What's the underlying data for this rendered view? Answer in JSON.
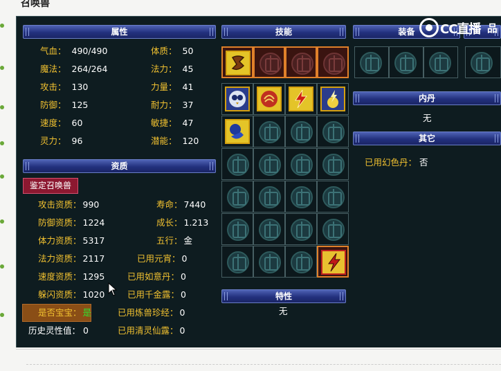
{
  "page": {
    "title": "召唤兽"
  },
  "attributes": {
    "header": "属性",
    "left": [
      {
        "label": "气血：",
        "value": "490/490"
      },
      {
        "label": "魔法：",
        "value": "264/264"
      },
      {
        "label": "攻击：",
        "value": "130"
      },
      {
        "label": "防御：",
        "value": "125"
      },
      {
        "label": "速度：",
        "value": "60"
      },
      {
        "label": "灵力：",
        "value": "96"
      }
    ],
    "right": [
      {
        "label": "体质：",
        "value": "50"
      },
      {
        "label": "法力：",
        "value": "45"
      },
      {
        "label": "力量：",
        "value": "41"
      },
      {
        "label": "耐力：",
        "value": "37"
      },
      {
        "label": "敏捷：",
        "value": "47"
      },
      {
        "label": "潜能：",
        "value": "120"
      }
    ]
  },
  "aptitude": {
    "header": "资质",
    "identify_button": "鉴定召唤兽",
    "left": [
      {
        "label": "攻击资质：",
        "value": "990"
      },
      {
        "label": "防御资质：",
        "value": "1224"
      },
      {
        "label": "体力资质：",
        "value": "5317"
      },
      {
        "label": "法力资质：",
        "value": "2117"
      },
      {
        "label": "速度资质：",
        "value": "1295"
      },
      {
        "label": "躲闪资质：",
        "value": "1020"
      },
      {
        "label": "是否宝宝：",
        "value": "是"
      },
      {
        "label": "历史灵性值：",
        "value": "0"
      }
    ],
    "right": [
      {
        "label": "寿命：",
        "value": "7440"
      },
      {
        "label": "成长：",
        "value": "1.213"
      },
      {
        "label": "五行：",
        "value": "金"
      },
      {
        "label": "已用元宵：",
        "value": "0"
      },
      {
        "label": "已用如意丹：",
        "value": "0"
      },
      {
        "label": "已用千金露：",
        "value": "0"
      },
      {
        "label": "已用炼兽珍经：",
        "value": "0"
      },
      {
        "label": "已用清灵仙露：",
        "value": "0"
      }
    ]
  },
  "skills": {
    "header": "技能",
    "special_header": "特性",
    "special_value": "无",
    "icons": [
      "talisman-icon",
      "owl-icon",
      "brain-icon",
      "lightning-icon",
      "thunder-burst-icon",
      "orb-hand-icon",
      "lightning-strike-icon"
    ]
  },
  "equipment": {
    "header": "装备"
  },
  "neidan": {
    "header": "内丹",
    "value": "无"
  },
  "other": {
    "header": "其它",
    "label": "已用幻色丹：",
    "value": "否"
  },
  "watermark": {
    "brand": "CC直播",
    "suffix": "品"
  },
  "colors": {
    "label": "#f0c030",
    "value": "#ffffff",
    "panel": "#0e1c20",
    "header": "#23317e"
  }
}
